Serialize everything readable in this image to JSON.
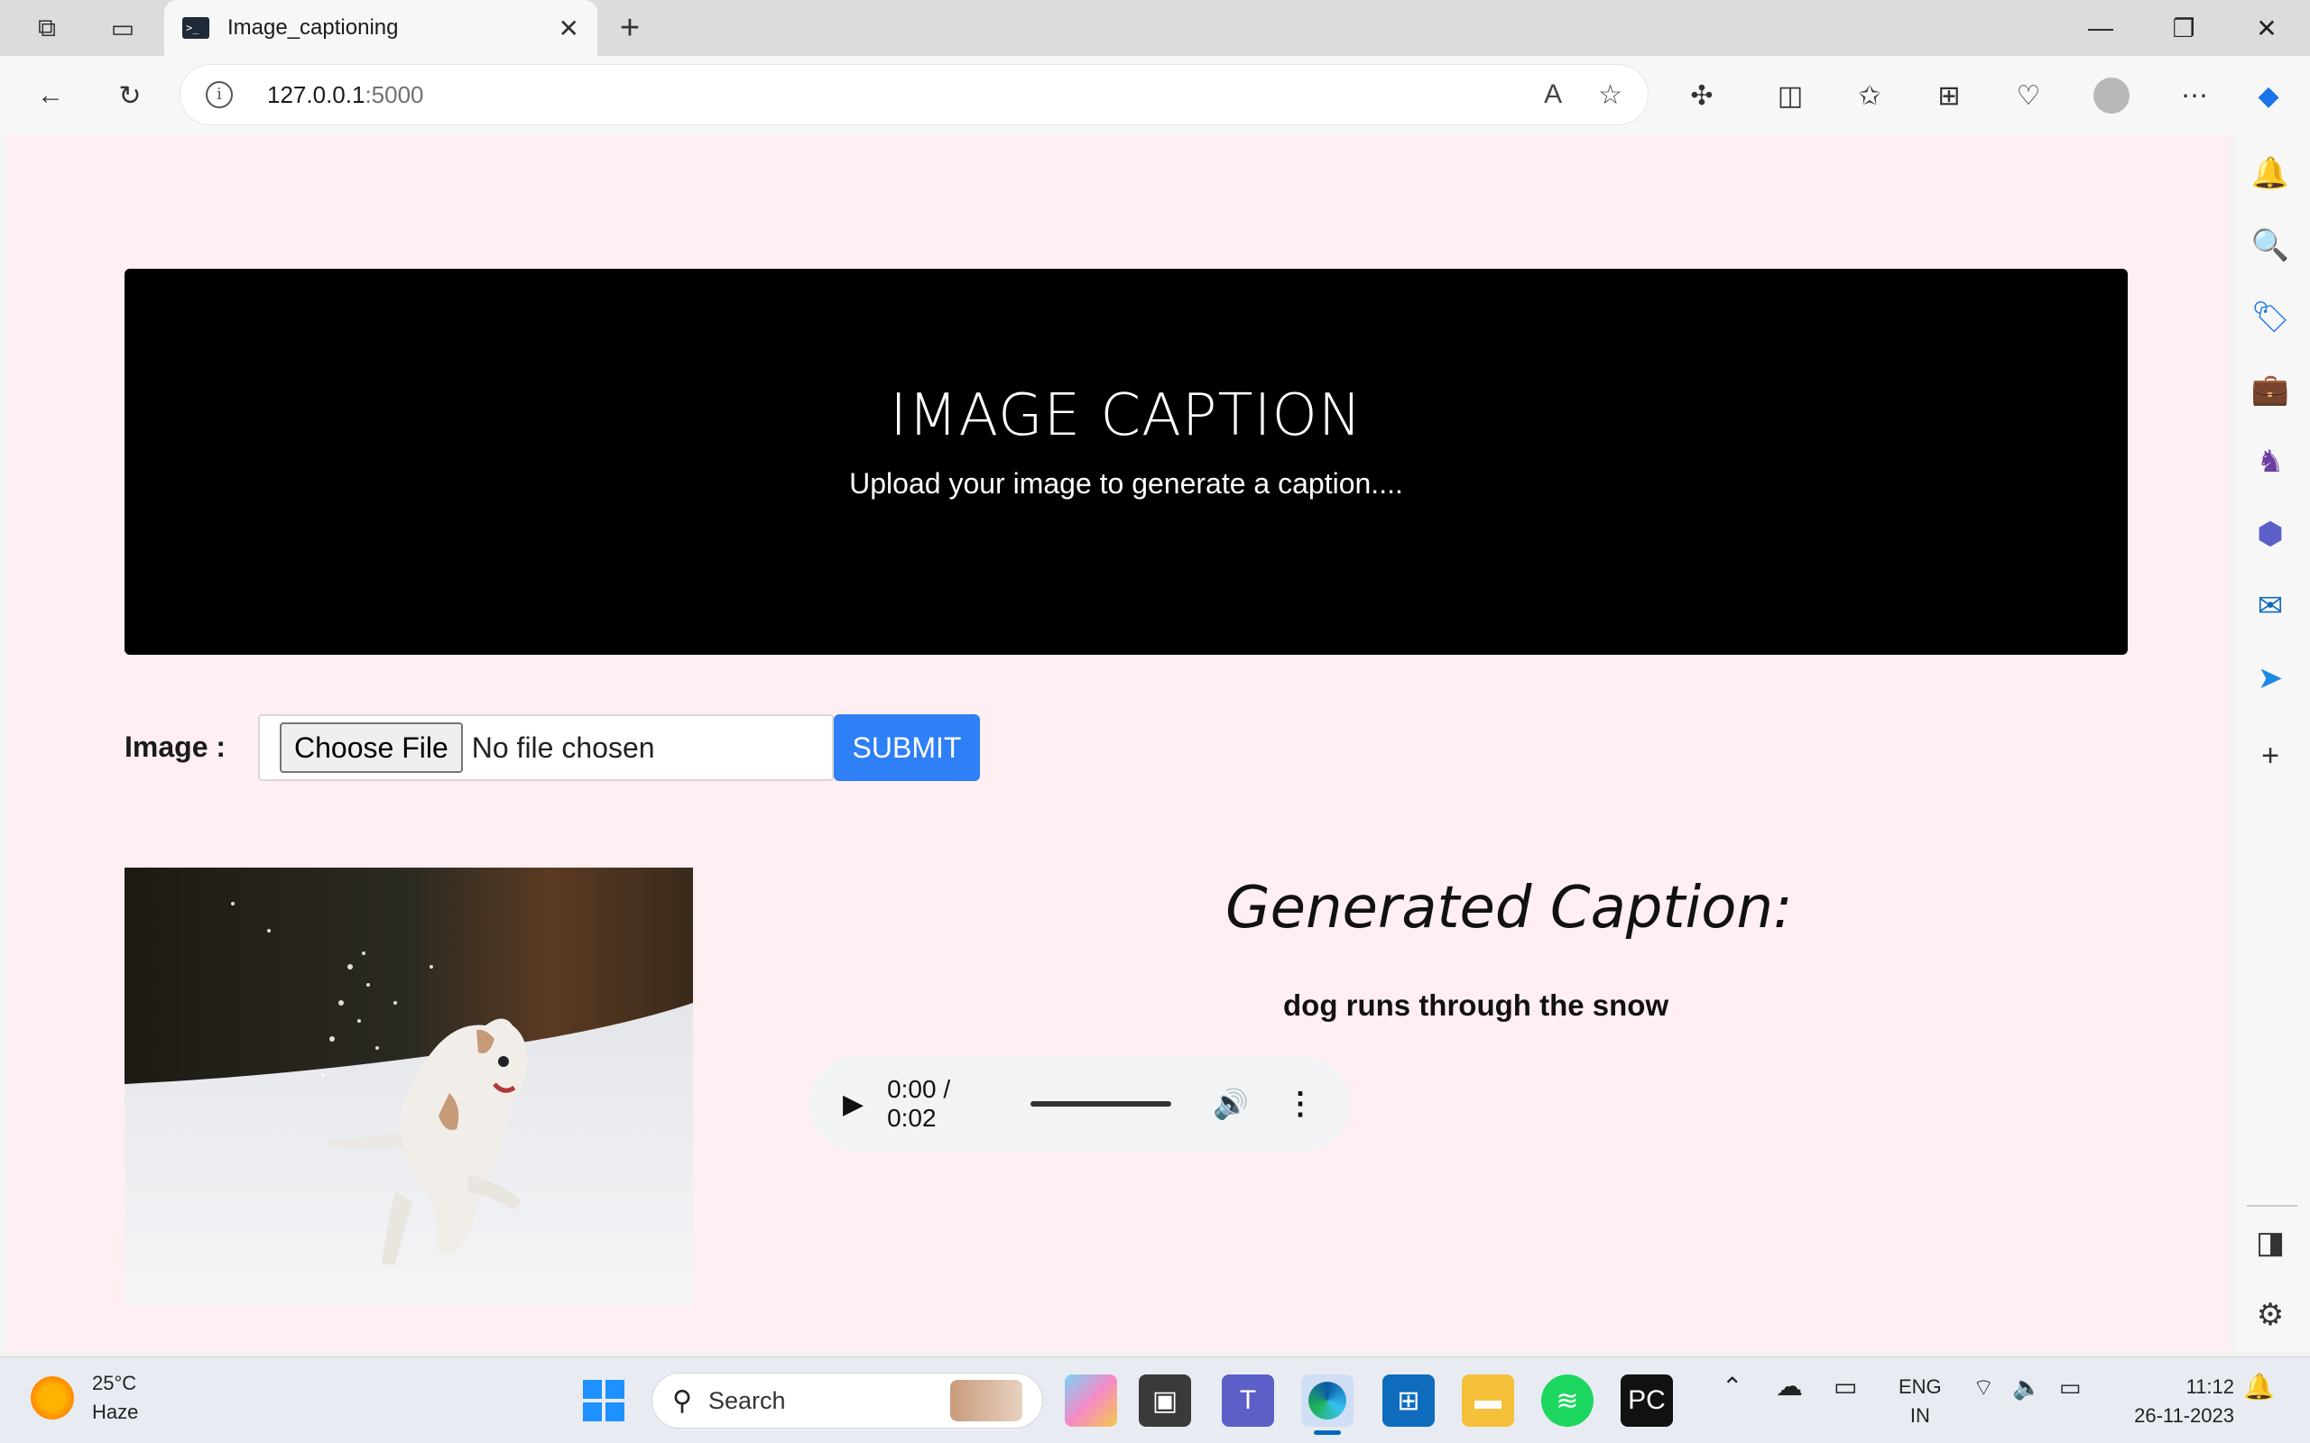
{
  "browser": {
    "tab_title": "Image_captioning",
    "tab_favicon": ">_",
    "url_host": "127.0.0.1",
    "url_port": ":5000"
  },
  "hero": {
    "title": "IMAGE CAPTION",
    "subtitle": "Upload your image to generate a caption...."
  },
  "form": {
    "image_label": "Image :",
    "choose_file_label": "Choose File",
    "no_file_text": "No file chosen",
    "submit_label": "SUBMIT"
  },
  "result": {
    "heading": "Generated Caption:",
    "caption": "dog runs through the snow",
    "audio_time": "0:00 / 0:02"
  },
  "taskbar": {
    "weather_temp": "25°C",
    "weather_desc": "Haze",
    "search_label": "Search",
    "lang_top": "ENG",
    "lang_bottom": "IN",
    "time": "11:12",
    "date": "26-11-2023"
  },
  "colors": {
    "page_bg": "#ffeef2",
    "hero_bg": "#000000",
    "submit_bg": "#2f7ff6"
  }
}
